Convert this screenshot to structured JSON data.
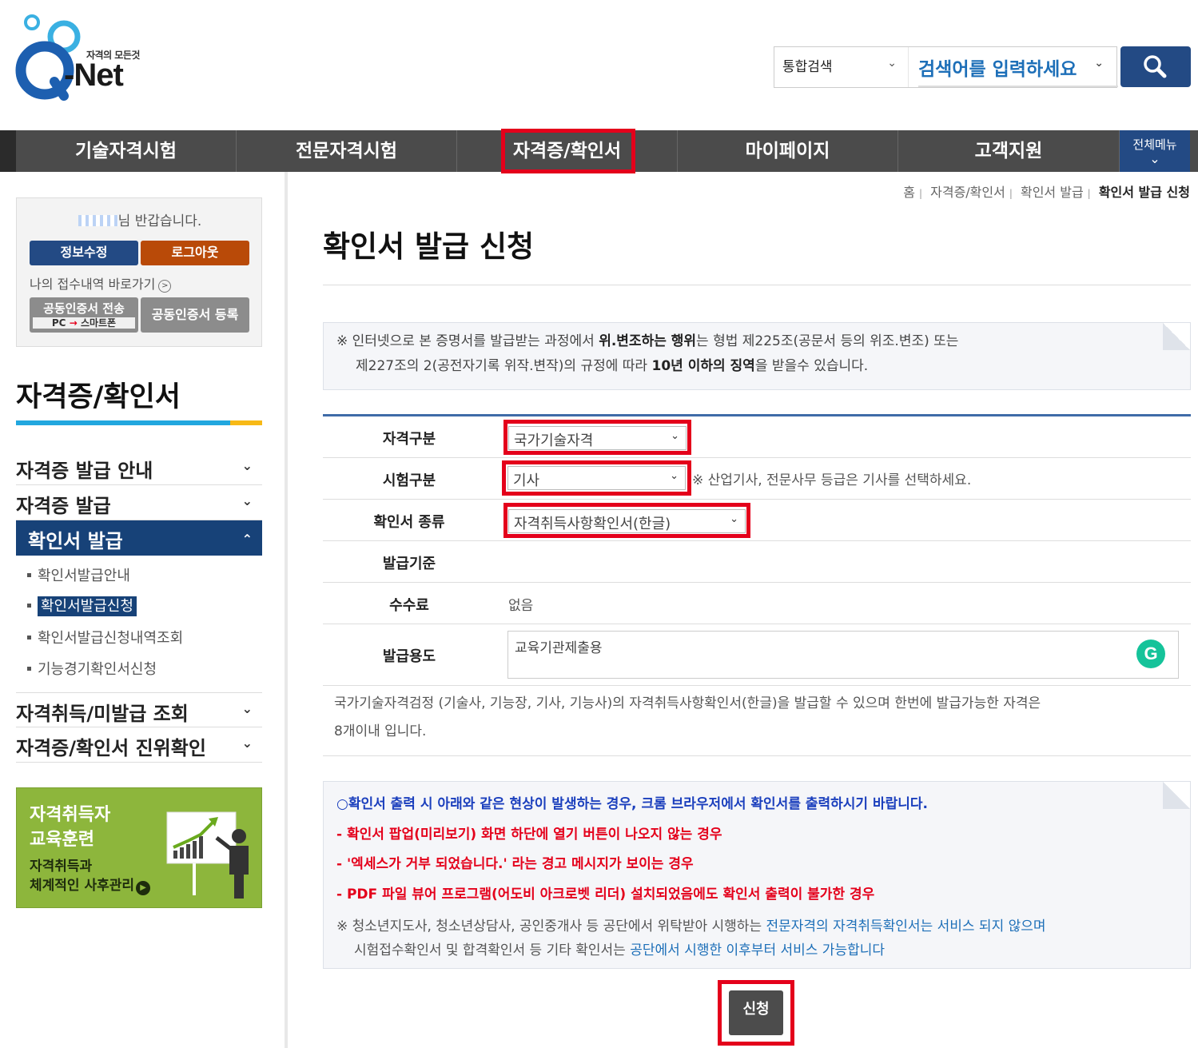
{
  "header": {
    "logo_tagline": "자격의 모든것",
    "logo_word": "-Net",
    "search_scope": "통합검색",
    "search_placeholder": "검색어를 입력하세요"
  },
  "nav": {
    "items": [
      "기술자격시험",
      "전문자격시험",
      "자격증/확인서",
      "마이페이지",
      "고객지원"
    ],
    "all_menu": "전체메뉴",
    "active_index": 2
  },
  "breadcrumb": [
    "홈",
    "자격증/확인서",
    "확인서 발급",
    "확인서 발급 신청"
  ],
  "userbox": {
    "greeting_suffix": "님 반갑습니다.",
    "edit_info": "정보수정",
    "logout": "로그아웃",
    "receipt_link": "나의 접수내역 바로가기",
    "cert_transfer": "공동인증서 전송",
    "cert_transfer_sub_from": "PC",
    "cert_transfer_sub_to": "스마트폰",
    "cert_register": "공동인증서 등록"
  },
  "sidebar": {
    "title": "자격증/확인서",
    "menus": [
      {
        "label": "자격증 발급 안내"
      },
      {
        "label": "자격증 발급"
      },
      {
        "label": "확인서 발급"
      }
    ],
    "submenu": [
      "확인서발급안내",
      "확인서발급신청",
      "확인서발급신청내역조회",
      "기능경기확인서신청"
    ],
    "menus_after": [
      {
        "label": "자격취득/미발급 조회"
      },
      {
        "label": "자격증/확인서 진위확인"
      }
    ],
    "banner": {
      "line1": "자격취득자",
      "line2": "교육훈련",
      "line3": "자격취득과",
      "line4": "체계적인 사후관리"
    }
  },
  "main": {
    "title": "확인서 발급 신청",
    "notice": {
      "p1a": "※ 인터넷으로 본 증명서를 발급받는 과정에서 ",
      "p1b": "위.변조하는 행위",
      "p1c": "는 형법 제225조(공문서 등의 위조.변조) 또는",
      "p2a": "제227조의 2(공전자기록 위작.변작)의 규정에 따라 ",
      "p2b": "10년 이하의 징역",
      "p2c": "을 받을수 있습니다."
    },
    "form": {
      "qual_label": "자격구분",
      "qual_value": "국가기술자격",
      "exam_label": "시험구분",
      "exam_value": "기사",
      "exam_hint": "※ 산업기사, 전문사무 등급은 기사를 선택하세요.",
      "type_label": "확인서 종류",
      "type_value": "자격취득사항확인서(한글)",
      "basis_label": "발급기준",
      "fee_label": "수수료",
      "fee_value": "없음",
      "purpose_label": "발급용도",
      "purpose_value": "교육기관제출용"
    },
    "description_l1": "국가기술자격검정 (기술사, 기능장, 기사, 기능사)의 자격취득사항확인서(한글)을 발급할 수 있으며 한번에 발급가능한 자격은",
    "description_l2": "8개이내 입니다.",
    "notice2": {
      "blue": "○확인서 출력 시 아래와 같은 현상이 발생하는 경우, 크롬 브라우저에서 확인서를 출력하시기 바랍니다.",
      "red1": "- 확인서 팝업(미리보기) 화면 하단에 열기 버튼이 나오지 않는 경우",
      "red2": "- '엑세스가 거부 되었습니다.' 라는 경고 메시지가 보이는 경우",
      "red3": "- PDF 파일 뷰어 프로그램(어도비 아크로벳 리더) 설치되었음에도 확인서 출력이 불가한 경우",
      "gray1a": "※ 청소년지도사, 청소년상담사, 공인중개사 등 공단에서 위탁받아 시행하는 ",
      "gray1b": "전문자격의 자격취득확인서는 서비스 되지 않으며",
      "gray2a": "시험접수확인서 및 합격확인서 등 기타 확인서는 ",
      "gray2b": "공단에서 시행한 이후부터 서비스 가능합니다"
    },
    "submit": "신청"
  },
  "colors": {
    "nav_bg": "#4b4b4b",
    "brand_navy": "#174278",
    "highlight_red": "#e4001b",
    "accent_blue": "#22a7df",
    "accent_yellow": "#f7b916",
    "banner_green": "#8db63c"
  }
}
